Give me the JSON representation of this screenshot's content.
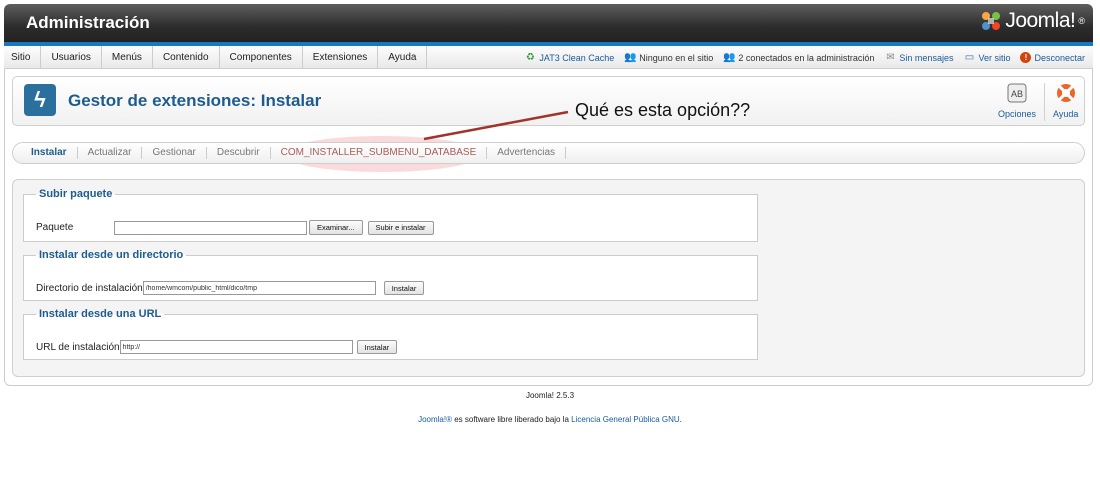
{
  "header": {
    "title": "Administración",
    "logo_text": "Joomla!",
    "logo_reg": "®"
  },
  "menu": {
    "items": [
      "Sitio",
      "Usuarios",
      "Menús",
      "Contenido",
      "Componentes",
      "Extensiones",
      "Ayuda"
    ]
  },
  "status": {
    "cache": "JAT3 Clean Cache",
    "site_users": "Ninguno en el sitio",
    "admin_users": "2 conectados en la administración",
    "messages": "Sin mensajes",
    "view_site": "Ver sitio",
    "logout": "Desconectar"
  },
  "toolbar": {
    "title": "Gestor de extensiones: Instalar",
    "options_label": "Opciones",
    "help_label": "Ayuda"
  },
  "annotation": {
    "text": "Qué es esta opción??"
  },
  "subnav": {
    "items": [
      "Instalar",
      "Actualizar",
      "Gestionar",
      "Descubrir",
      "COM_INSTALLER_SUBMENU_DATABASE",
      "Advertencias"
    ],
    "active": "Instalar"
  },
  "upload": {
    "legend": "Subir paquete",
    "label": "Paquete",
    "browse_button": "Examinar...",
    "submit_button": "Subir e instalar"
  },
  "directory": {
    "legend": "Instalar desde un directorio",
    "label": "Directorio de instalación",
    "value": "/home/wmcom/public_html/dico/tmp",
    "button": "Instalar"
  },
  "url": {
    "legend": "Instalar desde una URL",
    "label": "URL de instalación",
    "value": "http://",
    "button": "Instalar"
  },
  "footer": {
    "version": "Joomla! 2.5.3",
    "brand": "Joomla!®",
    "text": " es software libre liberado bajo la ",
    "license": "Licencia General Pública GNU",
    "period": "."
  },
  "colors": {
    "brand_blue": "#1a78c2",
    "title_blue": "#1e5c8f",
    "header_dark": "#2c2c2c",
    "logout_red": "#d2440b",
    "annotation_arrow": "#a3322a"
  }
}
